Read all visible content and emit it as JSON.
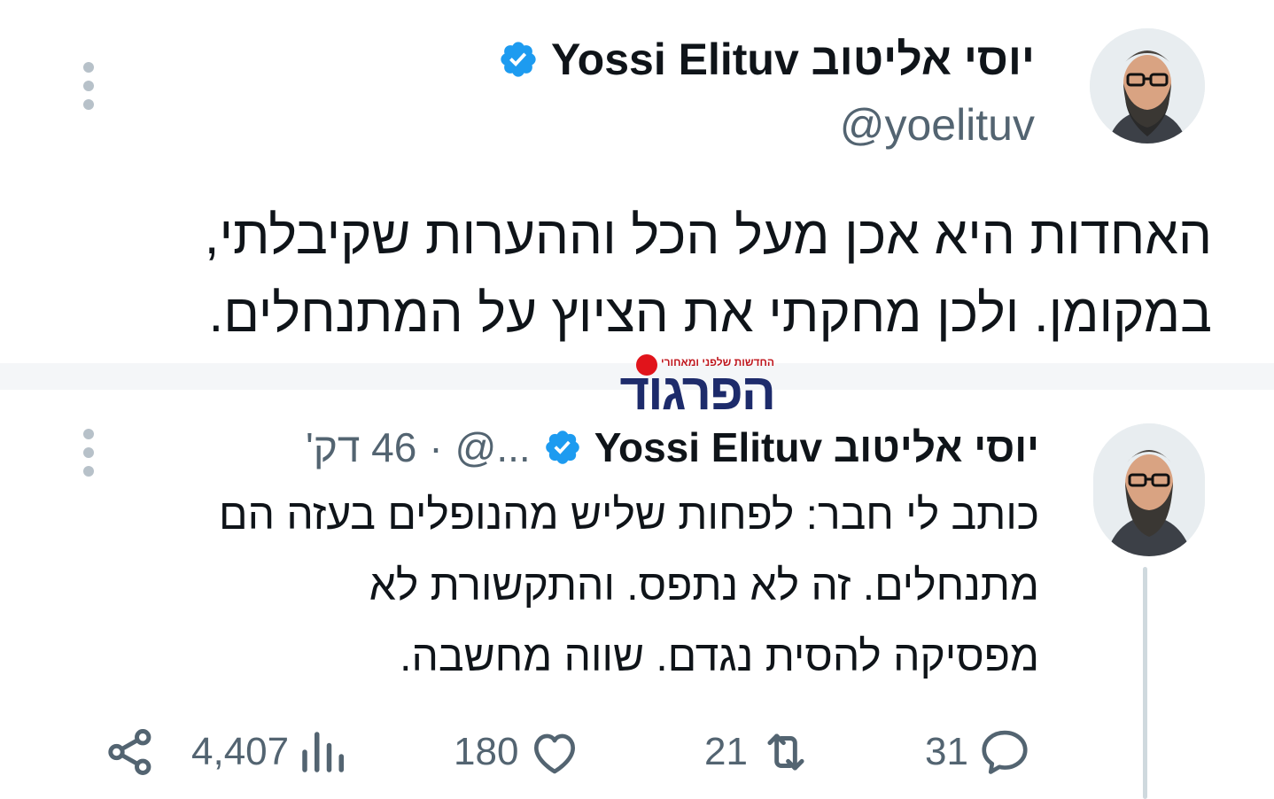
{
  "top_tweet": {
    "display_name": "Yossi Elituv יוסי אליטוב",
    "handle": "@yoelituv",
    "text_line1": "האחדות היא אכן מעל הכל וההערות שקיבלתי,",
    "text_line2": "במקומן. ולכן מחקתי את הציוץ על המתנחלים."
  },
  "watermark": {
    "tagline": "החדשות שלפני ומאחורי",
    "name": "הפרגוד"
  },
  "quoted_tweet": {
    "display_name": "Yossi Elituv יוסי אליטוב",
    "handle_truncated": "@...",
    "separator": "·",
    "time_ago": "46 דק'",
    "text_line1": "כותב לי חבר: לפחות שליש מהנופלים בעזה הם",
    "text_line2": "מתנחלים. זה לא נתפס. והתקשורת לא",
    "text_line3": "מפסיקה להסית נגדם. שווה מחשבה.",
    "actions": {
      "replies": "31",
      "retweets": "21",
      "likes": "180",
      "views": "4,407"
    }
  },
  "colors": {
    "verified": "#1d9bf0",
    "secondary_text": "#536471",
    "logo_navy": "#1d2b6b",
    "logo_red": "#e1141b"
  },
  "icons": [
    "more-vertical-icon",
    "verified-badge-icon",
    "reply-icon",
    "retweet-icon",
    "like-icon",
    "views-icon",
    "share-icon"
  ]
}
